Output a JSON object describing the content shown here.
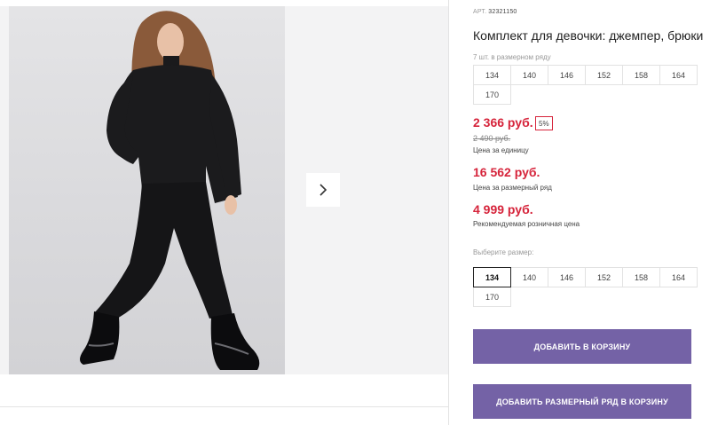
{
  "gallery": {
    "next_icon": "chevron-right-icon"
  },
  "product": {
    "art_label": "АРТ.",
    "art_value": "32321150",
    "title": "Комплект для девочки: джемпер, брюки",
    "pack_caption": "7 шт. в размерном ряду",
    "pack_sizes": [
      "134",
      "140",
      "146",
      "152",
      "158",
      "164",
      "170"
    ],
    "price": "2 366 руб.",
    "discount_badge": "5%",
    "old_price": "2 490 руб.",
    "price_note": "Цена за единицу",
    "pack_price": "16 562 руб.",
    "pack_price_note": "Цена за размерный ряд",
    "retail_price": "4 999 руб.",
    "retail_price_note": "Рекомендуемая розничная цена",
    "size_caption": "Выберите размер:",
    "sizes": [
      "134",
      "140",
      "146",
      "152",
      "158",
      "164",
      "170"
    ],
    "selected_size": "134"
  },
  "actions": {
    "add_to_cart": "ДОБАВИТЬ В КОРЗИНУ",
    "add_pack_to_cart": "ДОБАВИТЬ РАЗМЕРНЫЙ РЯД В КОРЗИНУ"
  },
  "colors": {
    "accent_button": "#7462a6",
    "price_red": "#d6243b"
  }
}
